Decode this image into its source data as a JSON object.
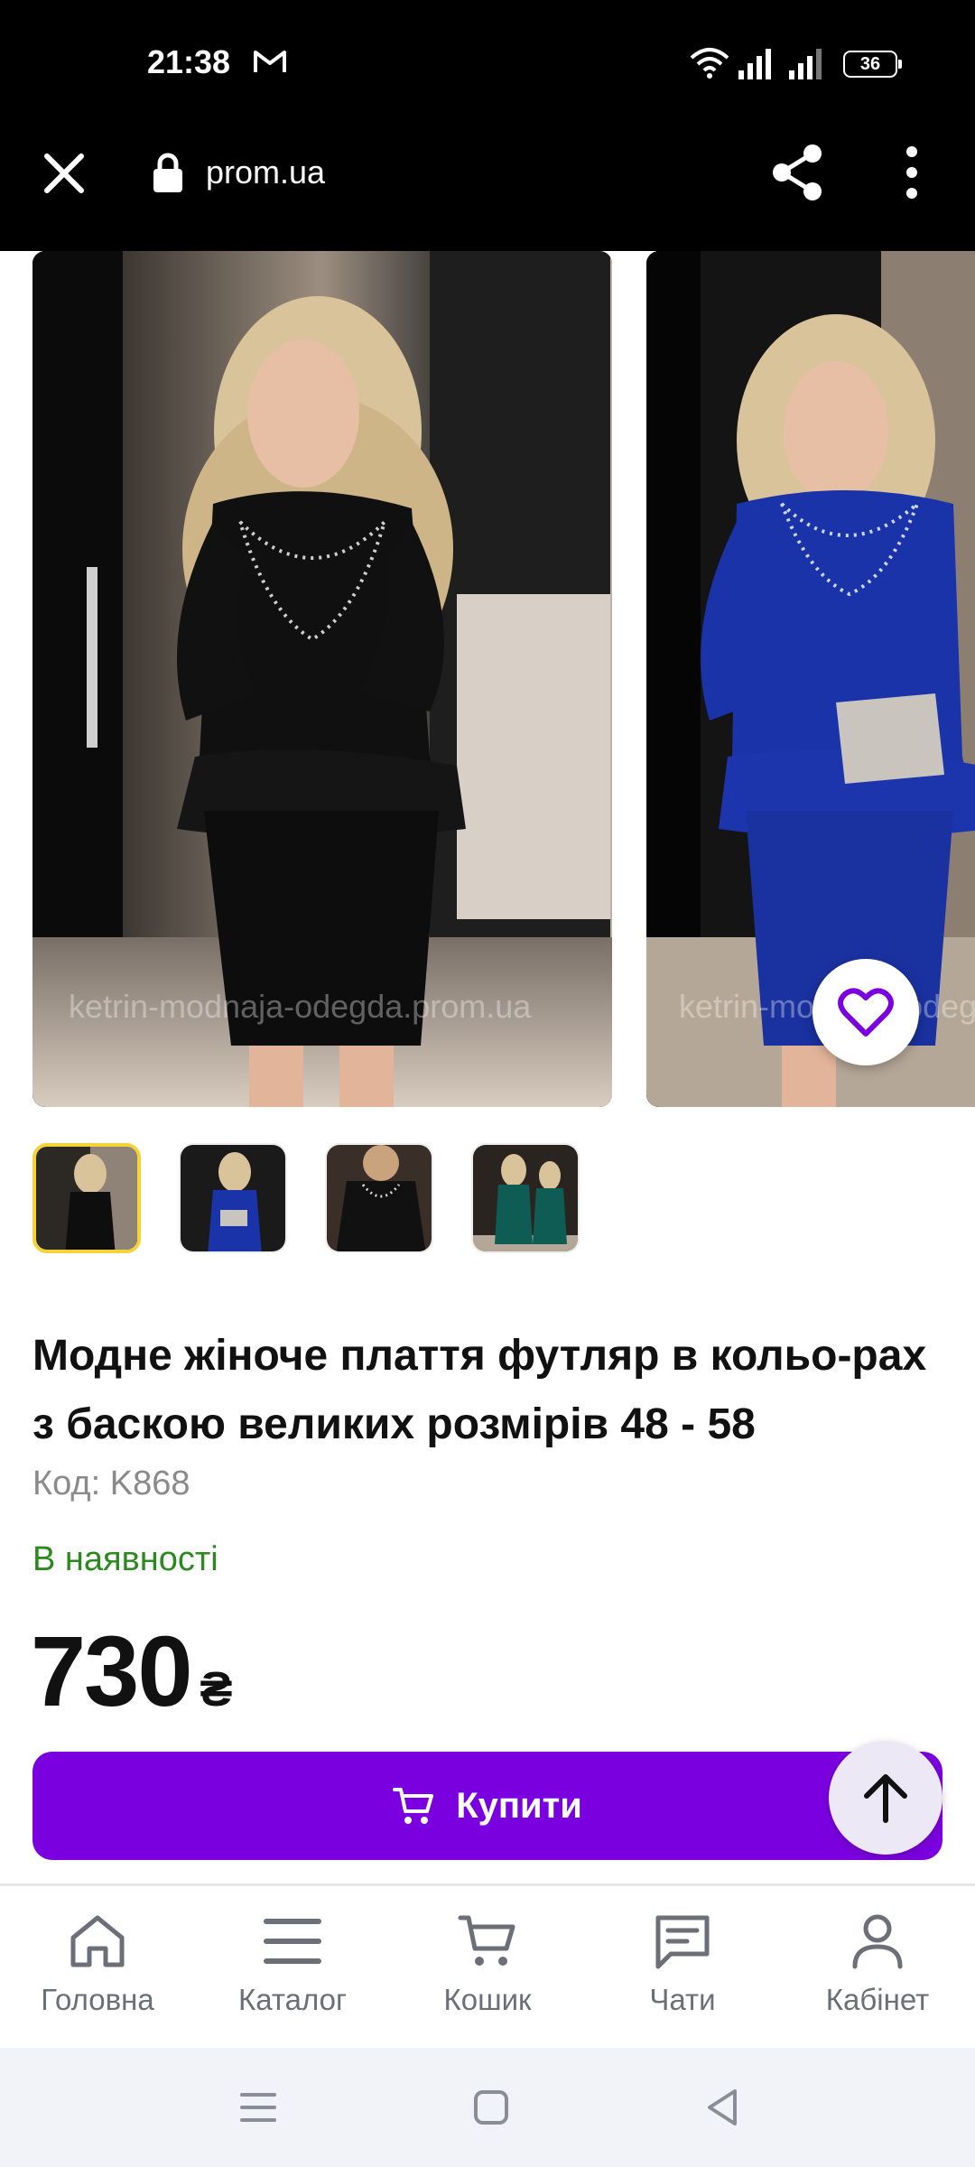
{
  "status_bar": {
    "time": "21:38",
    "battery": "36",
    "icons": [
      "gmail-icon",
      "wifi-icon",
      "signal-icon",
      "signal-icon",
      "battery-icon"
    ]
  },
  "browser": {
    "url": "prom.ua",
    "icons": [
      "close-icon",
      "lock-icon",
      "share-icon",
      "more-vert-icon"
    ]
  },
  "gallery": {
    "watermark": "ketrin-modnaja-odegda.prom.ua",
    "thumbnail_count": 4,
    "active_thumbnail": 1
  },
  "product": {
    "title": "Модне жіноче плаття футляр в кольо-рах з баскою великих розмірів 48 - 58",
    "sku": "Код: K868",
    "availability": "В наявності",
    "price": "730",
    "currency": "₴"
  },
  "actions": {
    "buy_label": "Купити"
  },
  "bottom_nav": {
    "items": [
      {
        "label": "Головна",
        "icon": "home-icon"
      },
      {
        "label": "Каталог",
        "icon": "catalog-menu-icon"
      },
      {
        "label": "Кошик",
        "icon": "cart-icon"
      },
      {
        "label": "Чати",
        "icon": "chat-icon"
      },
      {
        "label": "Кабінет",
        "icon": "profile-icon"
      }
    ]
  },
  "colors": {
    "accent": "#7b00e0",
    "in_stock": "#2b8a1e",
    "active_thumb_border": "#f4d23a"
  }
}
